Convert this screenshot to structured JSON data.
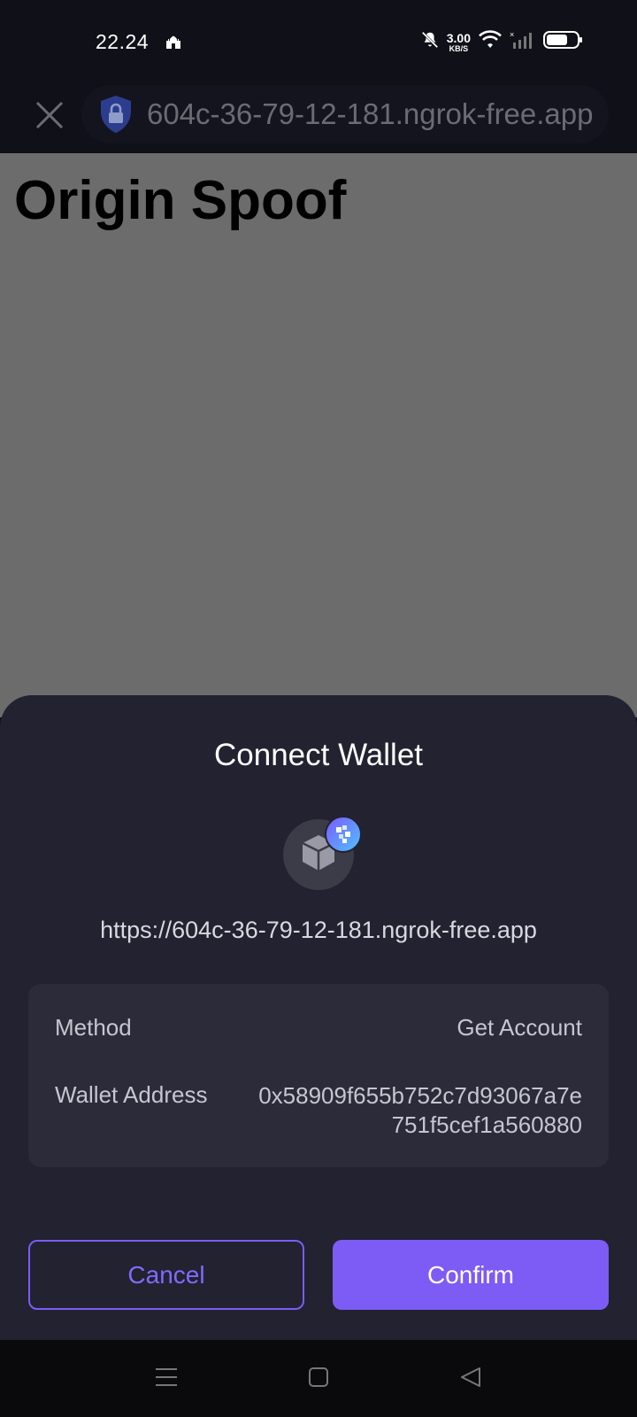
{
  "status_bar": {
    "time": "22.24",
    "speed_value": "3.00",
    "speed_unit": "KB/S",
    "icons": [
      "mosque-icon",
      "bell-off-icon",
      "wifi-icon",
      "signal-icon",
      "battery-icon"
    ]
  },
  "browser": {
    "url": "604c-36-79-12-181.ngrok-free.app",
    "close_icon": "close-icon",
    "lock_icon": "lock-shield-icon"
  },
  "web_page": {
    "title": "Origin Spoof"
  },
  "connect_sheet": {
    "title": "Connect Wallet",
    "site_url": "https://604c-36-79-12-181.ngrok-free.app",
    "details": {
      "method_label": "Method",
      "method_value": "Get Account",
      "address_label": "Wallet Address",
      "address_value": "0x58909f655b752c7d93067a7e751f5cef1a560880"
    },
    "cancel_label": "Cancel",
    "confirm_label": "Confirm"
  },
  "nav_bar": {
    "icons": [
      "menu-icon",
      "home-icon",
      "back-icon"
    ]
  },
  "colors": {
    "accent": "#7c5cf5",
    "sheet_bg": "#222230",
    "card_bg": "#2b2b3a",
    "overlay": "#6c6c6c"
  }
}
